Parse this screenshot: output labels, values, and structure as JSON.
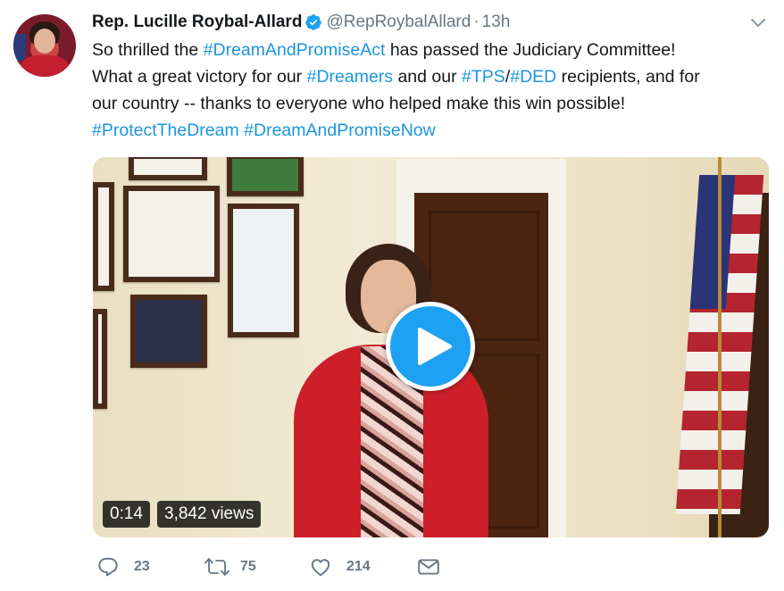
{
  "tweet": {
    "author_name": "Rep. Lucille Roybal-Allard",
    "handle": "@RepRoybalAllard",
    "separator": "·",
    "time": "13h",
    "lines": [
      [
        {
          "t": "So thrilled the "
        },
        {
          "t": "#DreamAndPromiseAct",
          "tag": true
        },
        {
          "t": " has passed the Judiciary Committee!"
        }
      ],
      [
        {
          "t": "What a great victory for our "
        },
        {
          "t": "#Dreamers",
          "tag": true
        },
        {
          "t": " and our "
        },
        {
          "t": "#TPS",
          "tag": true
        },
        {
          "t": "/"
        },
        {
          "t": "#DED",
          "tag": true
        },
        {
          "t": " recipients, and for"
        }
      ],
      [
        {
          "t": "our country -- thanks to everyone who helped make this win possible!"
        }
      ],
      [
        {
          "t": "#ProtectTheDream",
          "tag": true
        },
        {
          "t": " "
        },
        {
          "t": "#DreamAndPromiseNow",
          "tag": true
        }
      ]
    ]
  },
  "video": {
    "duration": "0:14",
    "views": "3,842 views"
  },
  "actions": {
    "replies": "23",
    "retweets": "75",
    "likes": "214"
  },
  "colors": {
    "link": "#1b95e0",
    "muted": "#657786",
    "play_button": "#1da1f2"
  },
  "icons": [
    "verified-icon",
    "chevron-down-icon",
    "play-icon",
    "reply-icon",
    "retweet-icon",
    "like-icon",
    "dm-icon"
  ]
}
